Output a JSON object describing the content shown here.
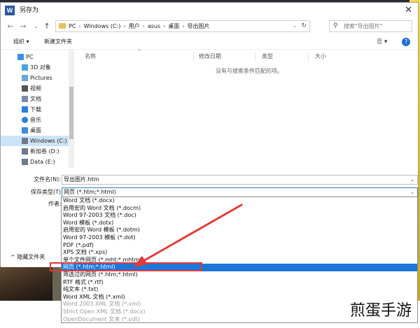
{
  "window": {
    "title": "另存为"
  },
  "nav": {
    "back": "←",
    "forward": "→",
    "down": "⌄",
    "up": "↑"
  },
  "address": {
    "crumbs": [
      "PC",
      "Windows (C:)",
      "用户",
      "asus",
      "桌面",
      "导出图片"
    ]
  },
  "search": {
    "placeholder": "搜索\"导出图片\""
  },
  "toolbar": {
    "organize": "组织 ▾",
    "new_folder": "新建文件夹",
    "view_icon": "view-options-icon",
    "help_icon": "help-icon"
  },
  "sidebar": {
    "items": [
      {
        "label": "PC",
        "icon": "pc-icon",
        "color": "#3a8ee6"
      },
      {
        "label": "3D 对象",
        "icon": "cube-icon",
        "color": "#4aa3df"
      },
      {
        "label": "Pictures",
        "icon": "pictures-icon",
        "color": "#6aa7d8"
      },
      {
        "label": "视频",
        "icon": "video-icon",
        "color": "#555555"
      },
      {
        "label": "文档",
        "icon": "document-icon",
        "color": "#7a8ea8"
      },
      {
        "label": "下载",
        "icon": "download-icon",
        "color": "#2b7fd9"
      },
      {
        "label": "音乐",
        "icon": "music-icon",
        "color": "#2b7fd9"
      },
      {
        "label": "桌面",
        "icon": "desktop-icon",
        "color": "#3c8be0"
      },
      {
        "label": "Windows (C:)",
        "icon": "drive-icon",
        "color": "#6d7a88"
      },
      {
        "label": "新加卷 (D:)",
        "icon": "drive-icon",
        "color": "#6d7a88"
      },
      {
        "label": "Data (E:)",
        "icon": "drive-icon",
        "color": "#6d7a88"
      }
    ]
  },
  "columns": [
    "名称",
    "修改日期",
    "类型",
    "大小"
  ],
  "empty_message": "没有与搜索条件匹配的项。",
  "form": {
    "filename_label": "文件名(N):",
    "filename_value": "导出图片.htm",
    "type_label": "保存类型(T):",
    "type_value": "网页 (*.htm;*.html)",
    "author_label": "作者:",
    "hide_folders": "^  隐藏文件夹"
  },
  "file_types": [
    {
      "label": "Word 文档 (*.docx)"
    },
    {
      "label": "启用宏的 Word 文档 (*.docm)"
    },
    {
      "label": "Word 97-2003 文档 (*.doc)"
    },
    {
      "label": "Word 模板 (*.dotx)"
    },
    {
      "label": "启用宏的 Word 模板 (*.dotm)"
    },
    {
      "label": "Word 97-2003 模板 (*.dot)"
    },
    {
      "label": "PDF (*.pdf)"
    },
    {
      "label": "XPS 文档 (*.xps)"
    },
    {
      "label": "单个文件网页 (*.mht;*.mhtml)"
    },
    {
      "label": "网页 (*.htm;*.html)",
      "selected": true
    },
    {
      "label": "筛选过的网页 (*.htm;*.html)"
    },
    {
      "label": "RTF 格式 (*.rtf)"
    },
    {
      "label": "纯文本 (*.txt)"
    },
    {
      "label": "Word XML 文档 (*.xml)"
    },
    {
      "label": "Word 2003 XML 文档 (*.xml)",
      "muted": true
    },
    {
      "label": "Strict Open XML 文档 (*.docx)",
      "muted": true
    },
    {
      "label": "OpenDocument 文本 (*.odt)",
      "muted": true
    }
  ],
  "colors": {
    "selected": "#1e76d8",
    "annotation": "#e23b3b"
  },
  "watermark": "煎蛋手游"
}
